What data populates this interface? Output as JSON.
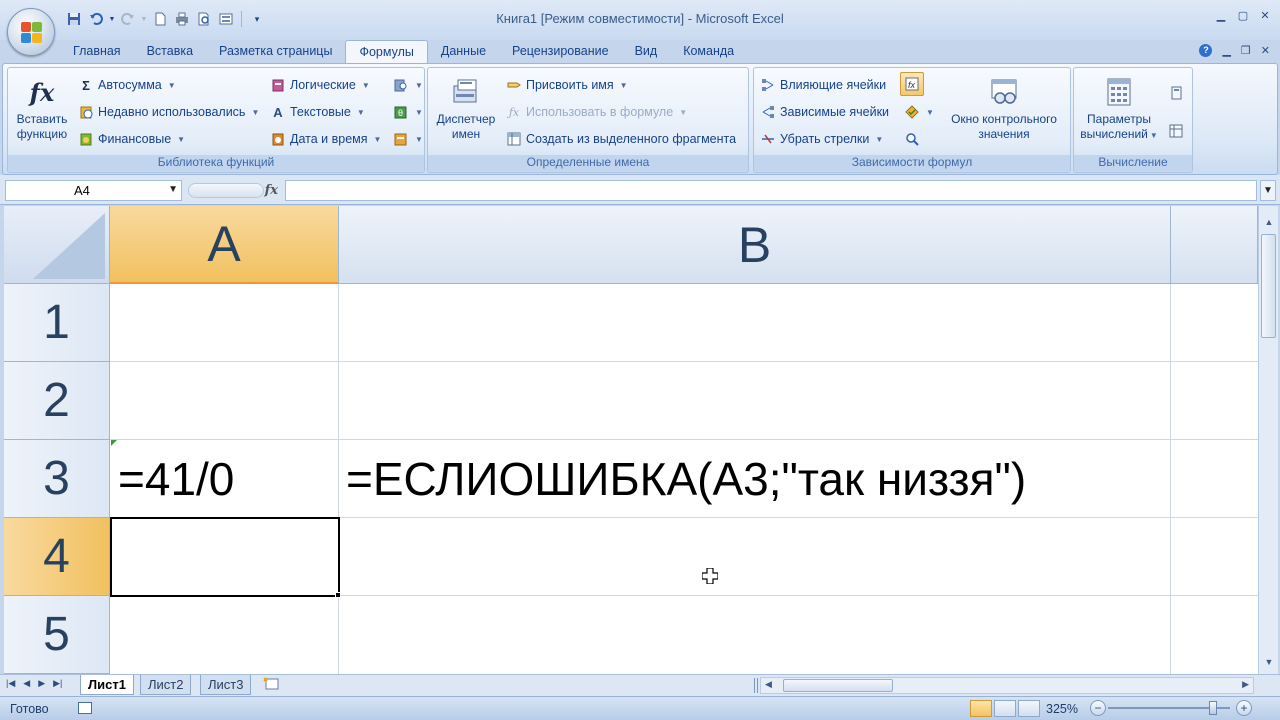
{
  "app": {
    "window_title": "Книга1  [Режим совместимости] - Microsoft Excel",
    "colors": {
      "ribbon_text": "#15428b",
      "selected_header": "#f1c15f",
      "grid_line": "#d0d7e5"
    }
  },
  "qat": {
    "icons": [
      "save-icon",
      "undo-icon",
      "redo-icon",
      "new-icon",
      "print-icon",
      "print-preview-icon",
      "form-icon",
      "customize-qat-icon"
    ]
  },
  "tabs": [
    "Главная",
    "Вставка",
    "Разметка страницы",
    "Формулы",
    "Данные",
    "Рецензирование",
    "Вид",
    "Команда"
  ],
  "active_tab": "Формулы",
  "ribbon": {
    "function_library": {
      "label": "Библиотека функций",
      "insert_function": "Вставить функцию",
      "insert_function_line1": "Вставить",
      "insert_function_line2": "функцию",
      "autosum": "Автосумма",
      "recently_used": "Недавно использовались",
      "financial": "Финансовые",
      "logical": "Логические",
      "text": "Текстовые",
      "date_time": "Дата и время"
    },
    "defined_names": {
      "label": "Определенные имена",
      "name_manager_line1": "Диспетчер",
      "name_manager_line2": "имен",
      "define_name": "Присвоить имя",
      "use_in_formula": "Использовать в формуле",
      "create_from_selection": "Создать из выделенного фрагмента"
    },
    "formula_auditing": {
      "label": "Зависимости формул",
      "trace_precedents": "Влияющие ячейки",
      "trace_dependents": "Зависимые ячейки",
      "remove_arrows": "Убрать стрелки",
      "watch_window_line1": "Окно контрольного",
      "watch_window_line2": "значения"
    },
    "calculation": {
      "label": "Вычисление",
      "calc_options_line1": "Параметры",
      "calc_options_line2": "вычислений"
    }
  },
  "formula_bar": {
    "name_box": "A4",
    "fx_label": "fx",
    "formula": ""
  },
  "grid": {
    "columns": [
      "A",
      "B"
    ],
    "rows": [
      "1",
      "2",
      "3",
      "4",
      "5"
    ],
    "selected_column": "A",
    "selected_row": "4",
    "cells": {
      "A3": "=41/0",
      "B3": "=ЕСЛИОШИБКА(A3;\"так низзя\")"
    }
  },
  "sheets": [
    "Лист1",
    "Лист2",
    "Лист3"
  ],
  "active_sheet": "Лист1",
  "status": {
    "ready": "Готово",
    "zoom": "325%"
  }
}
